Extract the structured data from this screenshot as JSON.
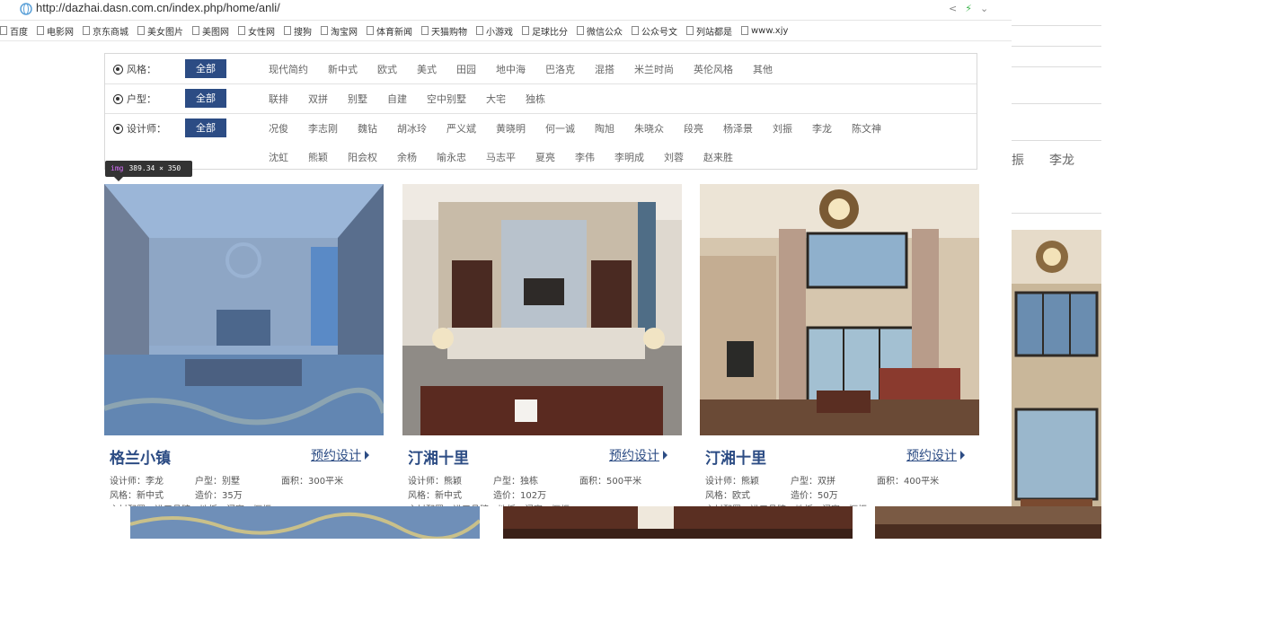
{
  "browser": {
    "url": "http://dazhai.dasn.com.cn/index.php/home/anli/",
    "bookmarks": [
      "百度",
      "电影网",
      "京东商城",
      "美女图片",
      "美图网",
      "女性网",
      "搜狗",
      "淘宝网",
      "体育新闻",
      "天猫购物",
      "小游戏",
      "足球比分",
      "微信公众",
      "公众号文",
      "列站都是",
      "www.xjy"
    ]
  },
  "filters": {
    "style": {
      "label": "风格：",
      "all": "全部",
      "options": [
        "现代简约",
        "新中式",
        "欧式",
        "美式",
        "田园",
        "地中海",
        "巴洛克",
        "混搭",
        "米兰时尚",
        "英伦风格",
        "其他"
      ]
    },
    "house": {
      "label": "户型：",
      "all": "全部",
      "options": [
        "联排",
        "双拼",
        "别墅",
        "自建",
        "空中别墅",
        "大宅",
        "独栋"
      ]
    },
    "designer": {
      "label": "设计师：",
      "all": "全部",
      "options_line1": [
        "况俊",
        "李志刚",
        "魏钻",
        "胡冰玲",
        "严义斌",
        "黄晓明",
        "何一诚",
        "陶旭",
        "朱晓众",
        "段亮",
        "杨泽景",
        "刘振",
        "李龙",
        "陈文神"
      ],
      "options_line2": [
        "沈虹",
        "熊颖",
        "阳会权",
        "余杨",
        "喻永忠",
        "马志平",
        "夏亮",
        "李伟",
        "李明成",
        "刘蓉",
        "赵来胜"
      ]
    }
  },
  "tooltip": {
    "tag": "img",
    "size": "389.34 × 350"
  },
  "background_text": [
    "振",
    "李龙"
  ],
  "cards": [
    {
      "title": "格兰小镇",
      "book": "预约设计",
      "designer": "设计师：李龙",
      "house": "户型：别墅",
      "area": "面积：300平米",
      "style": "风格：新中式",
      "price": "造价：35万",
      "extra": "主材配置：进口品牌，地板，门窗，橱柜"
    },
    {
      "title": "汀湘十里",
      "book": "预约设计",
      "designer": "设计师：熊颖",
      "house": "户型：独栋",
      "area": "面积：500平米",
      "style": "风格：新中式",
      "price": "造价：102万",
      "extra": "主材配置：进口品牌，地板，门窗，橱柜"
    },
    {
      "title": "汀湘十里",
      "book": "预约设计",
      "designer": "设计师：熊颖",
      "house": "户型：双拼",
      "area": "面积：400平米",
      "style": "风格：欧式",
      "price": "造价：50万",
      "extra": "主材配置：进口品牌，地板，门窗，橱柜"
    }
  ]
}
